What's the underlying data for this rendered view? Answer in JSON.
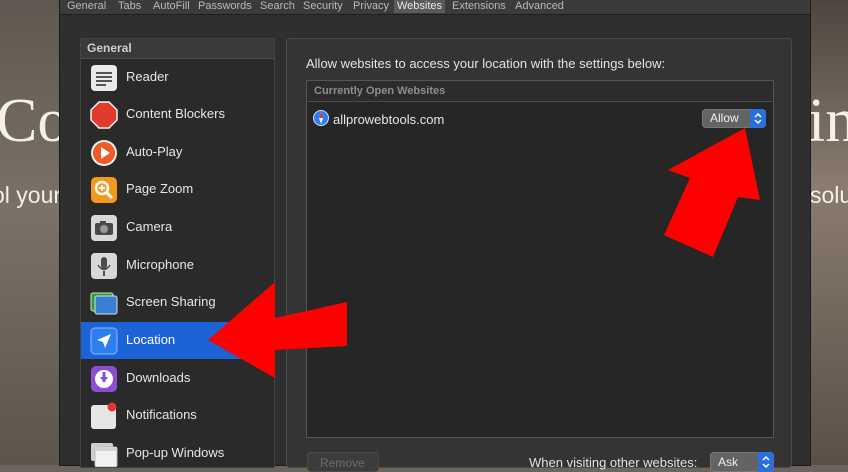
{
  "background": {
    "left_big_text": "Co",
    "left_small_text": "ol your",
    "right_big_text": "in",
    "right_small_text": "solu"
  },
  "tabs": [
    {
      "label": "General"
    },
    {
      "label": "Tabs"
    },
    {
      "label": "AutoFill"
    },
    {
      "label": "Passwords"
    },
    {
      "label": "Search"
    },
    {
      "label": "Security"
    },
    {
      "label": "Privacy"
    },
    {
      "label": "Websites",
      "active": true
    },
    {
      "label": "Extensions"
    },
    {
      "label": "Advanced"
    }
  ],
  "sidebar": {
    "section_title": "General",
    "items": [
      {
        "label": "Reader",
        "icon": "reader-icon"
      },
      {
        "label": "Content Blockers",
        "icon": "stop-sign-icon"
      },
      {
        "label": "Auto-Play",
        "icon": "play-icon"
      },
      {
        "label": "Page Zoom",
        "icon": "magnifier-icon"
      },
      {
        "label": "Camera",
        "icon": "camera-icon"
      },
      {
        "label": "Microphone",
        "icon": "microphone-icon"
      },
      {
        "label": "Screen Sharing",
        "icon": "screen-sharing-icon"
      },
      {
        "label": "Location",
        "icon": "location-arrow-icon",
        "selected": true
      },
      {
        "label": "Downloads",
        "icon": "download-icon"
      },
      {
        "label": "Notifications",
        "icon": "notifications-icon"
      },
      {
        "label": "Pop-up Windows",
        "icon": "popup-windows-icon"
      }
    ]
  },
  "main": {
    "description": "Allow websites to access your location with the settings below:",
    "table_header": "Currently Open Websites",
    "rows": [
      {
        "site": "allprowebtools.com",
        "setting": "Allow",
        "icon": "safari-compass-icon"
      }
    ],
    "remove_label": "Remove",
    "other_label": "When visiting other websites:",
    "other_value": "Ask"
  },
  "colors": {
    "selection": "#1b63d6",
    "annotation_arrow": "#ff0000"
  }
}
